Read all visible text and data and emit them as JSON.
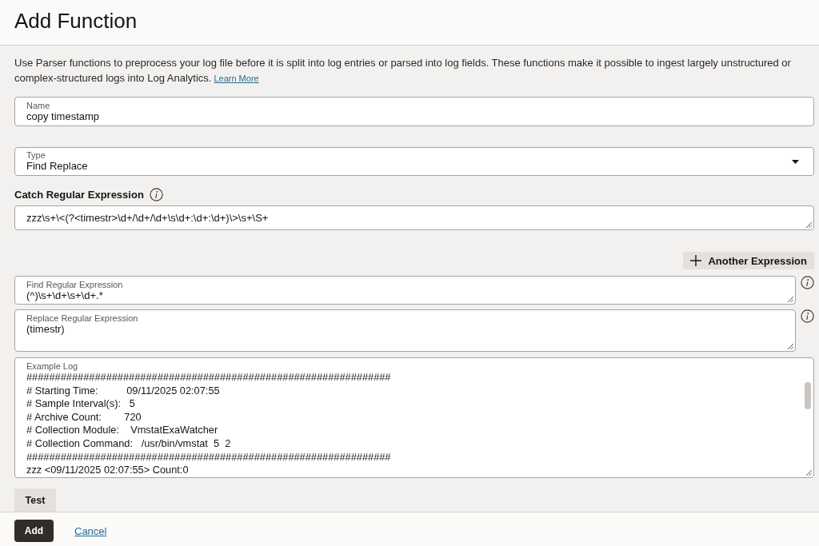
{
  "header": {
    "title": "Add Function"
  },
  "description": {
    "text": "Use Parser functions to preprocess your log file before it is split into log entries or parsed into log fields. These functions make it possible to ingest largely unstructured or complex-structured logs into Log Analytics.",
    "link": "Learn More"
  },
  "form": {
    "name": {
      "label": "Name",
      "value": "copy timestamp"
    },
    "type": {
      "label": "Type",
      "value": "Find Replace"
    },
    "catch_expression": {
      "label": "Catch Regular Expression",
      "value": "zzz\\s+\\<(?<timestr>\\d+/\\d+/\\d+\\s\\d+:\\d+:\\d+)\\>\\s+\\S+"
    },
    "another_expression_button": "Another Expression",
    "find_expression": {
      "label": "Find Regular Expression",
      "value": "(^)\\s+\\d+\\s+\\d+.*"
    },
    "replace_expression": {
      "label": "Replace Regular Expression",
      "value": "(timestr)"
    },
    "example_log": {
      "label": "Example Log",
      "lines": [
        "################################################################",
        "# Starting Time:          09/11/2025 02:07:55",
        "# Sample Interval(s):   5",
        "# Archive Count:        720",
        "# Collection Module:    VmstatExaWatcher",
        "# Collection Command:   /usr/bin/vmstat  5  2",
        "################################################################",
        "zzz <09/11/2025 02:07:55> Count:0"
      ]
    },
    "test_button": "Test"
  },
  "footer": {
    "buttons": [
      {
        "label": "Add",
        "kind": "primary"
      },
      {
        "label": "Cancel",
        "kind": "link"
      }
    ]
  }
}
